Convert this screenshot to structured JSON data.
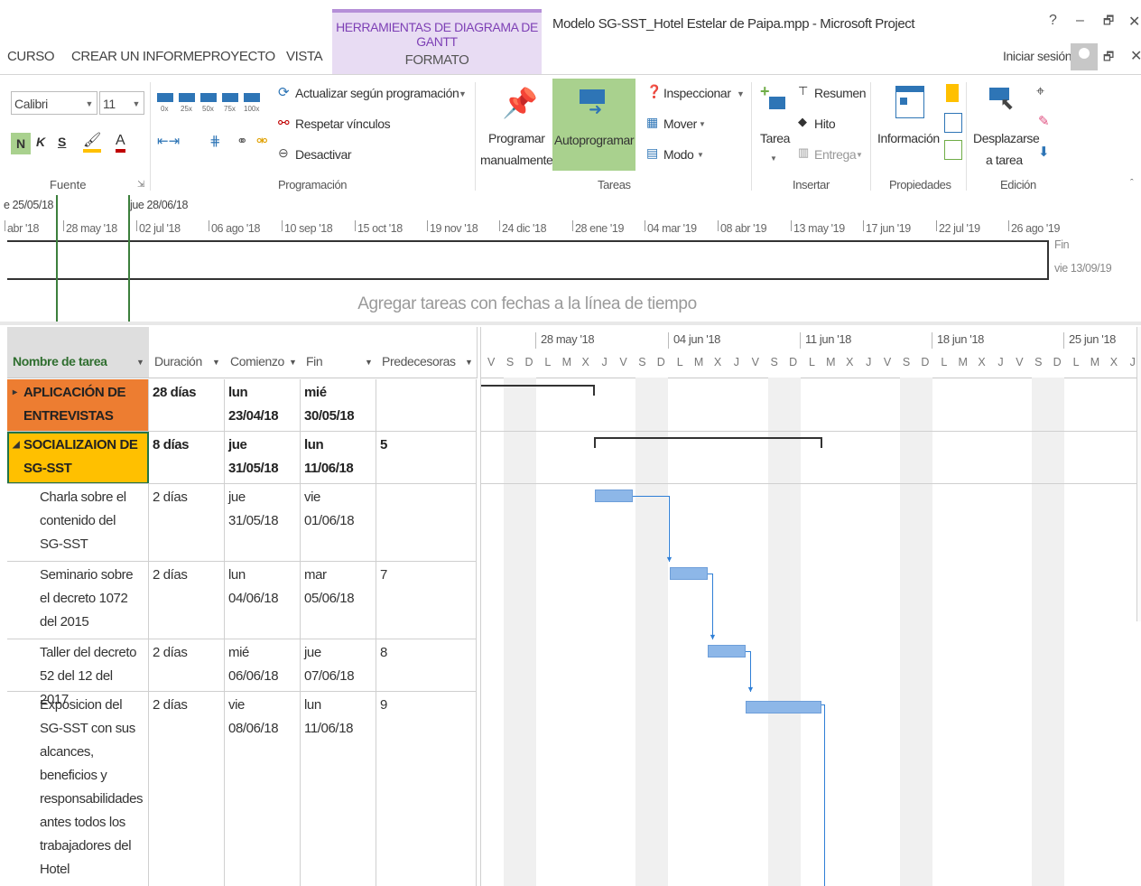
{
  "titlebar": {
    "context_tab": "HERRAMIENTAS DE DIAGRAMA DE GANTT",
    "context_subtab": "FORMATO",
    "window_title": "Modelo SG-SST_Hotel Estelar de Paipa.mpp - Microsoft Project",
    "help": "?",
    "minimize": "–",
    "restore": "🗗",
    "close": "✕"
  },
  "tabs": [
    "CURSO",
    "CREAR UN INFORME",
    "PROYECTO",
    "VISTA"
  ],
  "signin": "Iniciar sesión",
  "ribbon": {
    "font": {
      "name": "Calibri",
      "size": "11",
      "bold": "N",
      "italic": "K",
      "underline": "S",
      "label": "Fuente"
    },
    "schedule": {
      "update": "Actualizar según programación",
      "respect": "Respetar vínculos",
      "deactivate": "Desactivar",
      "label": "Programación",
      "pcts": [
        "0x",
        "25x",
        "50x",
        "75x",
        "100x"
      ]
    },
    "tasks": {
      "manual_line1": "Programar",
      "manual_line2": "manualmente",
      "auto": "Autoprogramar",
      "inspect": "Inspeccionar",
      "move": "Mover",
      "mode": "Modo",
      "label": "Tareas"
    },
    "insert": {
      "task": "Tarea",
      "summary": "Resumen",
      "milestone": "Hito",
      "deliverable": "Entrega",
      "label": "Insertar"
    },
    "properties": {
      "info": "Información",
      "label": "Propiedades"
    },
    "editing": {
      "scroll_line1": "Desplazarse",
      "scroll_line2": "a tarea",
      "label": "Edición"
    }
  },
  "timeline": {
    "start_label": "e 25/05/18",
    "current_label": "jue 28/06/18",
    "dates": [
      "abr '18",
      "28 may '18",
      "02 jul '18",
      "06 ago '18",
      "10 sep '18",
      "15 oct '18",
      "19 nov '18",
      "24 dic '18",
      "28 ene '19",
      "04 mar '19",
      "08 abr '19",
      "13 may '19",
      "17 jun '19",
      "22 jul '19",
      "26 ago '19"
    ],
    "hint": "Agregar tareas con fechas a la línea de tiempo",
    "finish_label": "Fin",
    "finish_date": "vie 13/09/19"
  },
  "grid": {
    "headers": [
      "Nombre de tarea",
      "Duración",
      "Comienzo",
      "Fin",
      "Predecesoras"
    ],
    "rows": [
      {
        "name": "APLICACIÓN DE\nENTREVISTAS",
        "duration": "28 días",
        "start": "lun\n23/04/18",
        "finish": "mié\n30/05/18",
        "pred": "",
        "marker": "▸"
      },
      {
        "name": "SOCIALIZAION DE\nSG-SST",
        "duration": "8 días",
        "start": "jue\n31/05/18",
        "finish": "lun\n11/06/18",
        "pred": "5",
        "marker": "◢"
      },
      {
        "name": "Charla sobre el\ncontenido del\nSG-SST",
        "duration": "2 días",
        "start": "jue\n31/05/18",
        "finish": "vie 01/06/18",
        "pred": ""
      },
      {
        "name": "Seminario sobre\nel decreto 1072\ndel 2015",
        "duration": "2 días",
        "start": "lun\n04/06/18",
        "finish": "mar\n05/06/18",
        "pred": "7"
      },
      {
        "name": "Taller del decreto\n52  del 12 del 2017",
        "duration": "2 días",
        "start": "mié\n06/06/18",
        "finish": "jue\n07/06/18",
        "pred": "8"
      },
      {
        "name": "Exposicion del\nSG-SST con sus\nalcances,\nbeneficios y\nresponsabilidades\nantes todos los\ntrabajadores del\nHotel",
        "duration": "2 días",
        "start": "vie 08/06/18",
        "finish": "lun\n11/06/18",
        "pred": "9"
      }
    ]
  },
  "gantt": {
    "weeks": [
      "28 may '18",
      "04 jun '18",
      "11 jun '18",
      "18 jun '18",
      "25 jun '18"
    ],
    "days": [
      "V",
      "S",
      "D",
      "L",
      "M",
      "X",
      "J",
      "V",
      "S",
      "D",
      "L",
      "M",
      "X",
      "J",
      "V",
      "S",
      "D",
      "L",
      "M",
      "X",
      "J",
      "V",
      "S",
      "D",
      "L",
      "M",
      "X",
      "J",
      "V",
      "S",
      "D",
      "L",
      "M",
      "X",
      "J"
    ]
  },
  "colors": {
    "context_purple": "#7d3fb5",
    "summary_orange": "#ed7d31",
    "summary_yellow": "#ffc000",
    "active_button_green": "#a9d18e",
    "bar_blue": "#8db7e8",
    "link_blue": "#2f7fd6"
  }
}
